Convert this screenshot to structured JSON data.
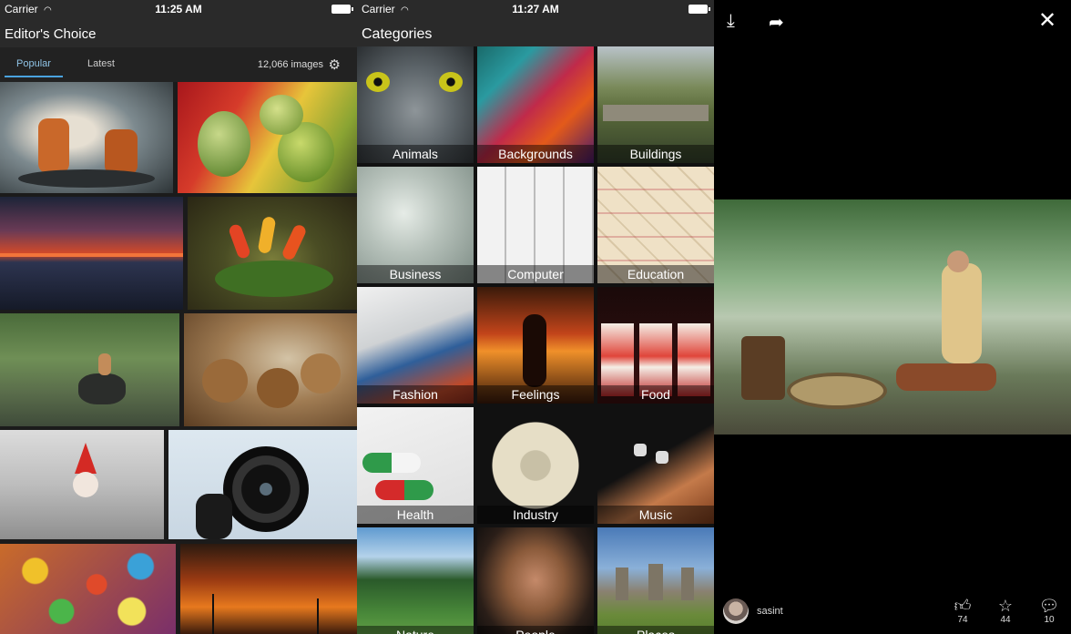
{
  "editors_choice": {
    "status": {
      "carrier": "Carrier",
      "time": "11:25 AM"
    },
    "title": "Editor's Choice",
    "tabs": [
      {
        "label": "Popular"
      },
      {
        "label": "Latest"
      }
    ],
    "image_count": "12,066 images",
    "icons": {
      "wifi": "wifi-icon",
      "battery": "battery-icon",
      "settings": "gear-icon"
    }
  },
  "categories": {
    "status": {
      "carrier": "Carrier",
      "time": "11:27 AM"
    },
    "title": "Categories",
    "items": [
      {
        "label": "Animals"
      },
      {
        "label": "Backgrounds"
      },
      {
        "label": "Buildings"
      },
      {
        "label": "Business"
      },
      {
        "label": "Computer"
      },
      {
        "label": "Education"
      },
      {
        "label": "Fashion"
      },
      {
        "label": "Feelings"
      },
      {
        "label": "Food"
      },
      {
        "label": "Health"
      },
      {
        "label": "Industry"
      },
      {
        "label": "Music"
      },
      {
        "label": "Nature"
      },
      {
        "label": "People"
      },
      {
        "label": "Places"
      }
    ]
  },
  "viewer": {
    "icons": {
      "download": "download-icon",
      "share": "share-icon",
      "close": "close-icon"
    },
    "user": {
      "name": "sasint"
    },
    "stats": {
      "likes": "74",
      "favorites": "44",
      "comments": "10"
    }
  },
  "colors": {
    "accent": "#4aa3df",
    "bar": "#2a2a2a"
  }
}
